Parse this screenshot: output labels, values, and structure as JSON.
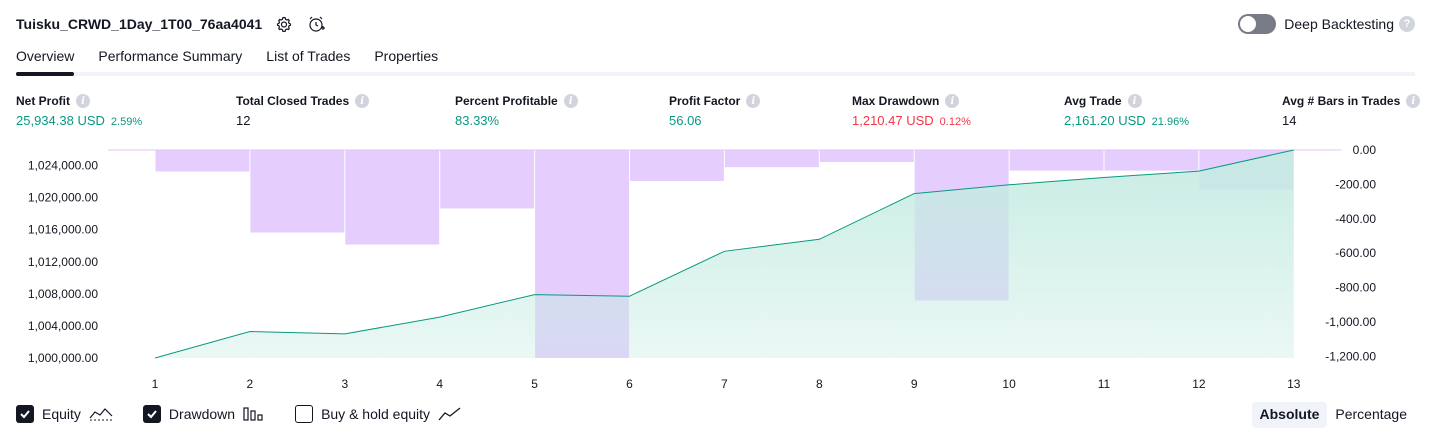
{
  "header": {
    "strategy_name": "Tuisku_CRWD_1Day_1T00_76aa4041",
    "settings_icon": "gear-icon",
    "alert_icon": "alarm-clock-plus-icon",
    "deep_backtesting_label": "Deep Backtesting",
    "deep_backtesting_enabled": false,
    "help_icon_text": "?"
  },
  "tabs": [
    {
      "label": "Overview",
      "active": true
    },
    {
      "label": "Performance Summary",
      "active": false
    },
    {
      "label": "List of Trades",
      "active": false
    },
    {
      "label": "Properties",
      "active": false
    }
  ],
  "metrics": {
    "net_profit": {
      "label": "Net Profit",
      "value": "25,934.38 USD",
      "pct": "2.59%"
    },
    "total_closed_trades": {
      "label": "Total Closed Trades",
      "value": "12"
    },
    "percent_profitable": {
      "label": "Percent Profitable",
      "value": "83.33%"
    },
    "profit_factor": {
      "label": "Profit Factor",
      "value": "56.06"
    },
    "max_drawdown": {
      "label": "Max Drawdown",
      "value": "1,210.47 USD",
      "pct": "0.12%"
    },
    "avg_trade": {
      "label": "Avg Trade",
      "value": "2,161.20 USD",
      "pct": "21.96%"
    },
    "avg_bars": {
      "label": "Avg # Bars in Trades",
      "value": "14"
    }
  },
  "chart_data": {
    "type": "area",
    "x": [
      1,
      2,
      3,
      4,
      5,
      6,
      7,
      8,
      9,
      10,
      11,
      12,
      13
    ],
    "series": [
      {
        "values": [
          1000000,
          1003300,
          1003000,
          1005100,
          1007900,
          1007700,
          1013300,
          1014800,
          1020500,
          1021600,
          1022500,
          1023300,
          1025934
        ],
        "color": "#089981",
        "fill": "#c5ebe2",
        "axis": "left"
      },
      {
        "values": [
          -125,
          -480,
          -550,
          -340,
          -1210,
          -180,
          -100,
          -70,
          -875,
          -120,
          -120,
          -230
        ],
        "color": "#e1c4fe",
        "axis": "right",
        "kind": "bar"
      }
    ],
    "left_ticks": [
      "1,000,000.00",
      "1,004,000.00",
      "1,008,000.00",
      "1,012,000.00",
      "1,016,000.00",
      "1,020,000.00",
      "1,024,000.00"
    ],
    "left_tick_values": [
      1000000,
      1004000,
      1008000,
      1012000,
      1016000,
      1020000,
      1024000
    ],
    "right_ticks": [
      "0.00",
      "-200.00",
      "-400.00",
      "-600.00",
      "-800.00",
      "-1,000.00",
      "-1,200.00"
    ],
    "right_tick_values": [
      0,
      -200,
      -400,
      -600,
      -800,
      -1000,
      -1200
    ],
    "x_labels": [
      "1",
      "2",
      "3",
      "4",
      "5",
      "6",
      "7",
      "8",
      "9",
      "10",
      "11",
      "12",
      "13"
    ],
    "ylim_left": [
      1000000,
      1025934
    ],
    "ylim_right": [
      -1210,
      0
    ],
    "grid": false
  },
  "legend": {
    "equity": {
      "label": "Equity",
      "checked": true
    },
    "drawdown": {
      "label": "Drawdown",
      "checked": true
    },
    "buy_hold": {
      "label": "Buy & hold equity",
      "checked": false
    }
  },
  "mode": {
    "absolute_label": "Absolute",
    "percentage_label": "Percentage",
    "selected": "Absolute"
  },
  "colors": {
    "positive": "#089981",
    "negative": "#f23645",
    "equity_fill": "#c5ebe2",
    "drawdown_fill": "#e1c4fe"
  }
}
